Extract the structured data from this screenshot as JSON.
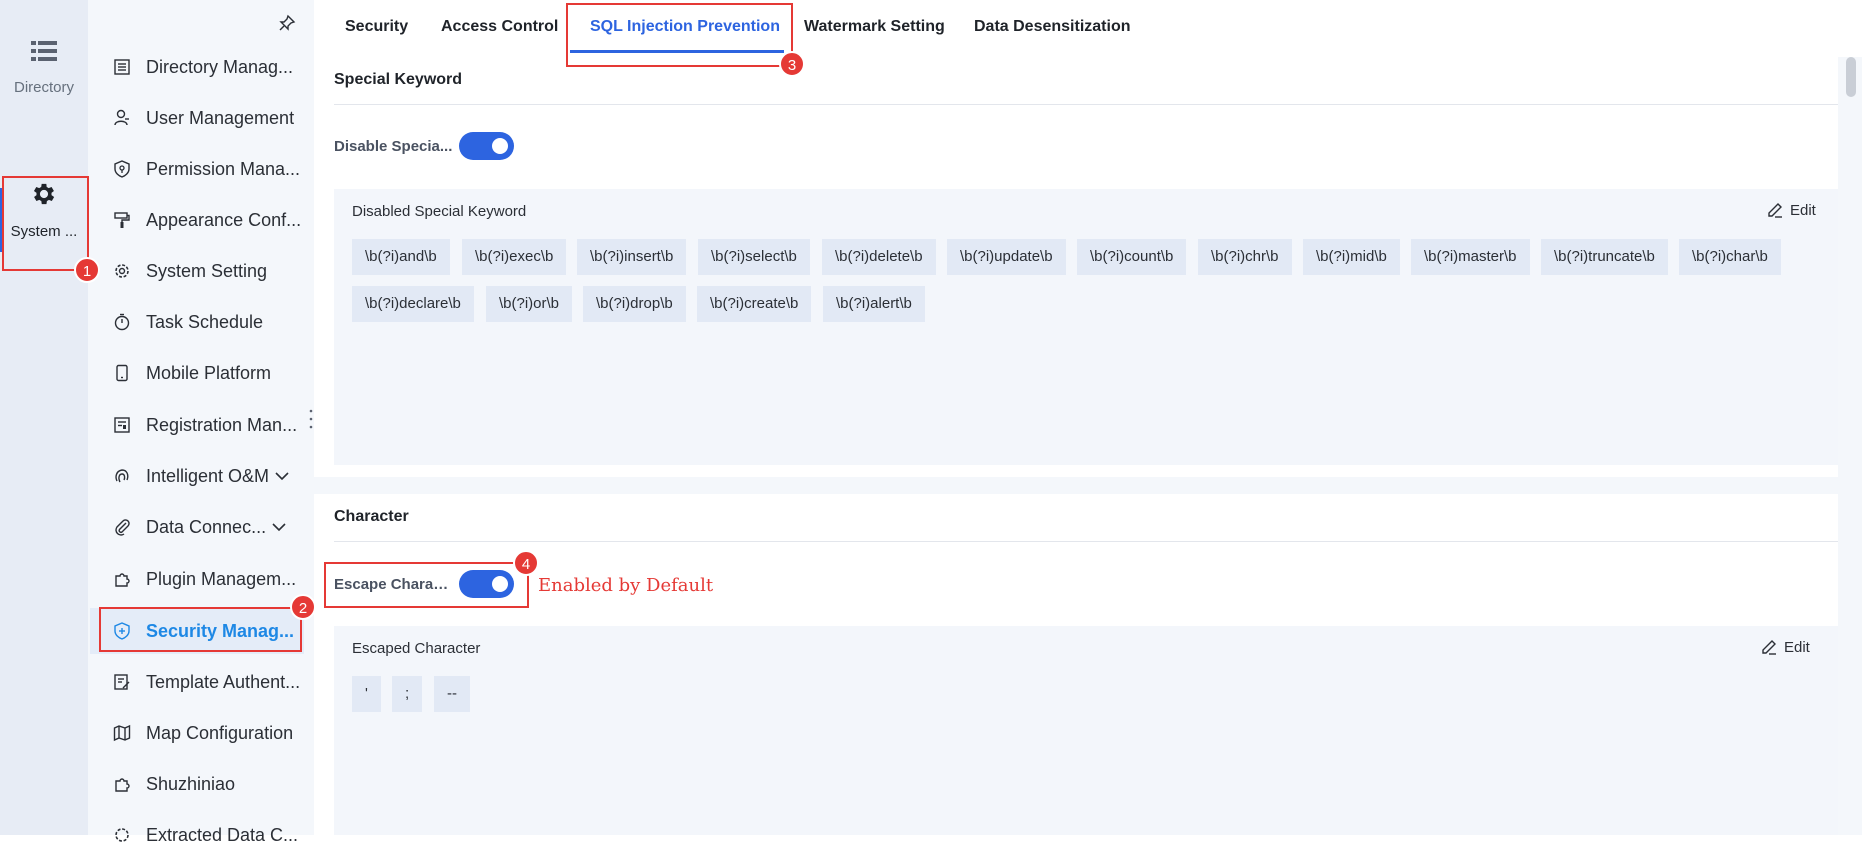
{
  "rail": {
    "items": [
      {
        "label": "Directory",
        "icon": "list-icon"
      },
      {
        "label": "System ...",
        "icon": "gear-icon"
      }
    ]
  },
  "subnav": {
    "items": [
      {
        "label": "Directory Manag...",
        "icon": "document-icon"
      },
      {
        "label": "User Management",
        "icon": "user-icon"
      },
      {
        "label": "Permission Mana...",
        "icon": "shield-key-icon"
      },
      {
        "label": "Appearance Conf...",
        "icon": "paint-roller-icon"
      },
      {
        "label": "System Setting",
        "icon": "gear-icon"
      },
      {
        "label": "Task Schedule",
        "icon": "timer-icon"
      },
      {
        "label": "Mobile Platform",
        "icon": "phone-icon"
      },
      {
        "label": "Registration Man...",
        "icon": "registration-icon"
      },
      {
        "label": "Intelligent O&M",
        "icon": "fingerprint-icon"
      },
      {
        "label": "Data Connec...",
        "icon": "paperclip-icon"
      },
      {
        "label": "Plugin Managem...",
        "icon": "puzzle-icon"
      },
      {
        "label": "Security Manag...",
        "icon": "shield-plus-icon"
      },
      {
        "label": "Template Authent...",
        "icon": "template-icon"
      },
      {
        "label": "Map Configuration",
        "icon": "map-icon"
      },
      {
        "label": "Shuzhiniao",
        "icon": "puzzle-icon"
      },
      {
        "label": "Extracted Data C...",
        "icon": "gear-icon"
      }
    ]
  },
  "tabs": [
    "Security",
    "Access Control",
    "SQL Injection Prevention",
    "Watermark Setting",
    "Data Desensitization"
  ],
  "active_tab": "SQL Injection Prevention",
  "special_keyword": {
    "section_title": "Special Keyword",
    "switch_label": "Disable Specia...",
    "switch_on": true,
    "panel_title": "Disabled Special Keyword",
    "edit_label": "Edit",
    "tags": [
      "\\b(?i)and\\b",
      "\\b(?i)exec\\b",
      "\\b(?i)insert\\b",
      "\\b(?i)select\\b",
      "\\b(?i)delete\\b",
      "\\b(?i)update\\b",
      "\\b(?i)count\\b",
      "\\b(?i)chr\\b",
      "\\b(?i)mid\\b",
      "\\b(?i)master\\b",
      "\\b(?i)truncate\\b",
      "\\b(?i)char\\b",
      "\\b(?i)declare\\b",
      "\\b(?i)or\\b",
      "\\b(?i)drop\\b",
      "\\b(?i)create\\b",
      "\\b(?i)alert\\b"
    ]
  },
  "character": {
    "section_title": "Character",
    "switch_label": "Escape Charac...",
    "switch_on": true,
    "panel_title": "Escaped Character",
    "edit_label": "Edit",
    "tags": [
      "'",
      ";",
      "--"
    ]
  },
  "annotations": {
    "badges": [
      "1",
      "2",
      "3",
      "4"
    ],
    "note": "Enabled by Default",
    "color": "#e53935"
  },
  "colors": {
    "accent": "#2d64e0",
    "active_nav": "#1e88e5"
  }
}
